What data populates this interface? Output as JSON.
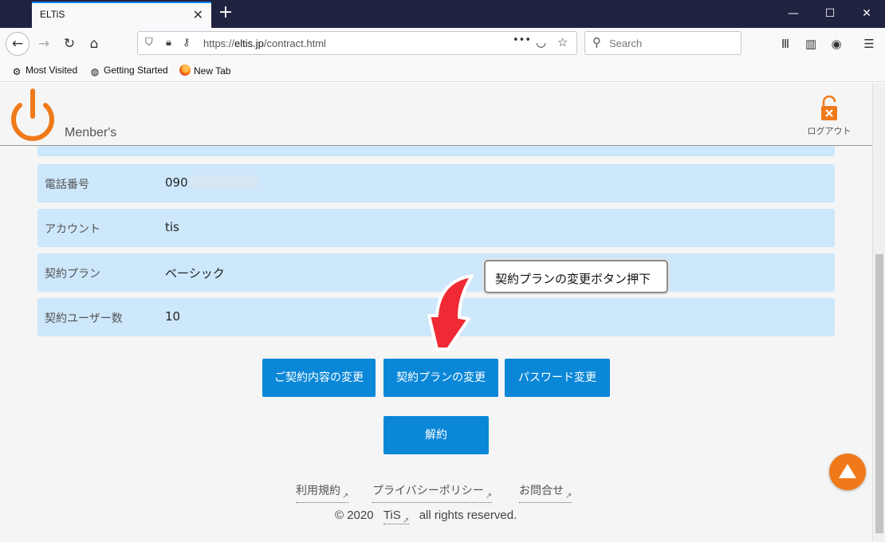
{
  "browser": {
    "tab_title": "ELTiS",
    "tab_close": "✕",
    "new_tab": "+",
    "window_controls": {
      "minimize": "—",
      "maximize": "☐",
      "close": "✕"
    },
    "url_prefix": "https://",
    "url_domain": "eltis.jp",
    "url_path": "/contract.html",
    "search_placeholder": "Search",
    "page_actions": "•••",
    "bookmarks": [
      {
        "label": "Most Visited",
        "icon": "gear-icon"
      },
      {
        "label": "Getting Started",
        "icon": "globe-icon"
      },
      {
        "label": "New Tab",
        "icon": "firefox-icon"
      }
    ]
  },
  "header": {
    "member_title": "Menber's",
    "logout_label": "ログアウト",
    "brand_color": "#f07a1a"
  },
  "rows": [
    {
      "label": "電話番号",
      "value": "090"
    },
    {
      "label": "アカウント",
      "value": "tis"
    },
    {
      "label": "契約プラン",
      "value": "ベーシック"
    },
    {
      "label": "契約ユーザー数",
      "value": "10"
    }
  ],
  "callout": {
    "text": "契約プランの変更ボタン押下"
  },
  "buttons": {
    "change_contract": "ご契約内容の変更",
    "change_plan": "契約プランの変更",
    "change_password": "パスワード変更",
    "cancel_contract": "解約"
  },
  "footer": {
    "terms": "利用規約",
    "privacy": "プライバシーポリシー",
    "contact": "お問合せ",
    "copyright_prefix": "© 2020",
    "company": "TiS",
    "copyright_suffix": "all rights reserved."
  },
  "colors": {
    "row_bg": "#cde7fb",
    "button_bg": "#0b87d8",
    "arrow_red": "#f02a35"
  }
}
